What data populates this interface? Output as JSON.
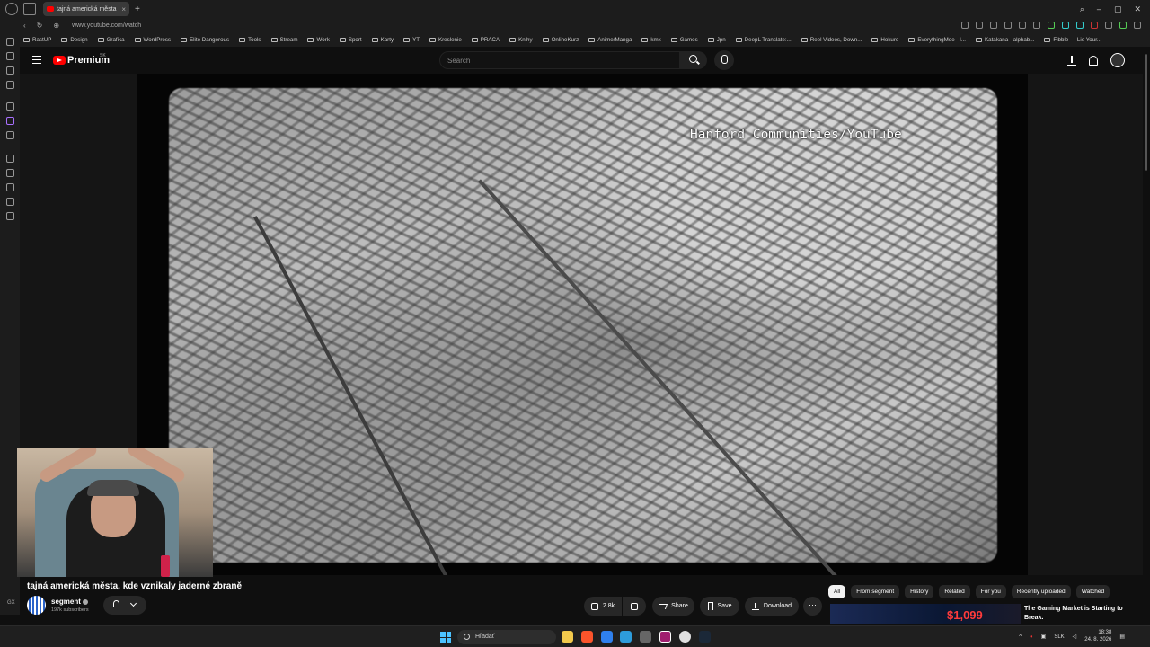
{
  "browser": {
    "tab_title": "tajná americká města",
    "new_tab": "+",
    "url": "www.youtube.com/watch",
    "bookmarks": [
      "RastUP",
      "Design",
      "Grafika",
      "WordPress",
      "Elite Dangerous",
      "Tools",
      "Stream",
      "Work",
      "Sport",
      "Karty",
      "YT",
      "Kreslenie",
      "PRACA",
      "Knihy",
      "OnlineKurz",
      "Anime/Manga",
      "kmx",
      "Games",
      "Jpn",
      "DeepL Translate:...",
      "Reel Videos, Down...",
      "Hokuro",
      "EverythingMoe - I...",
      "Katakana - alphab...",
      "Fibble — Lie Your..."
    ]
  },
  "youtube": {
    "logo_text": "Premium",
    "country_code": "SK",
    "search_placeholder": "Search"
  },
  "player": {
    "watermark": "Hanford Communities/YouTube"
  },
  "video": {
    "title": "tajná americká města, kde vznikaly jaderné zbraně",
    "channel_name": "segment",
    "subscribers": "197k subscribers",
    "like_count": "2.8k",
    "share_label": "Share",
    "save_label": "Save",
    "download_label": "Download",
    "more_label": "···"
  },
  "chips": [
    "All",
    "From segment",
    "History",
    "Related",
    "For you",
    "Recently uploaded",
    "Watched"
  ],
  "recommendation": {
    "price_text": "$1,099",
    "title": "The Gaming Market is Starting to Break."
  },
  "side_label": "GX",
  "taskbar": {
    "search_label": "Hľadať",
    "lang": "SLK",
    "time": "18:38",
    "date": "24. 8. 2026"
  },
  "colors": {
    "background": "#0f0f0f",
    "accent_red": "#ff0000",
    "pill_bg": "#272727"
  }
}
